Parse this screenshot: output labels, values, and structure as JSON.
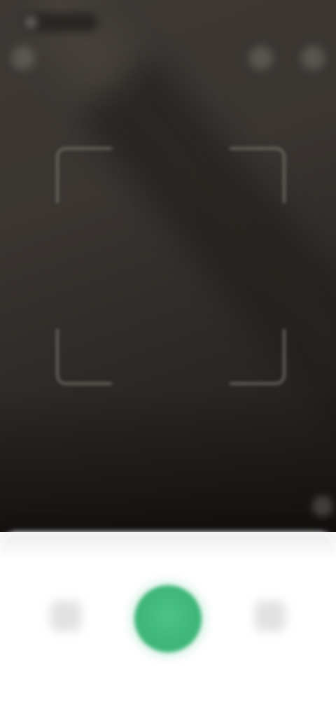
{
  "app": {
    "mode": "camera-scanner"
  },
  "status_bar": {
    "time_icon": "status-time-icon"
  },
  "top_bar": {
    "left_icon": "flash-icon",
    "right_icons": [
      "settings-icon",
      "more-icon"
    ]
  },
  "scanner": {
    "frame": "scan-frame"
  },
  "controls": {
    "left_icon": "gallery-icon",
    "center_icon": "shutter-icon",
    "right_icon": "switch-camera-icon"
  },
  "colors": {
    "accent": "#46bd80",
    "viewfinder_bg": "#3a3531",
    "panel_bg": "#ffffff"
  }
}
